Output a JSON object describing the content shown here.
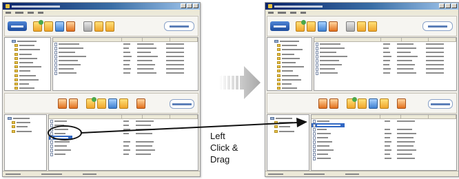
{
  "instruction": {
    "line1": "Left",
    "line2": "Click &",
    "line3": "Drag"
  },
  "colors": {
    "selection": "#3168c4",
    "titlebar": "#0a246a",
    "arrow": "#111111",
    "transition_arrow": "#bdbdbd"
  },
  "icons": {
    "toolbar": [
      "logo",
      "folder-tool",
      "folder-tool",
      "folder-tool",
      "folder-tool",
      "doc-tool",
      "folder-tool",
      "folder-tool"
    ],
    "drag_item": "file-icon"
  }
}
